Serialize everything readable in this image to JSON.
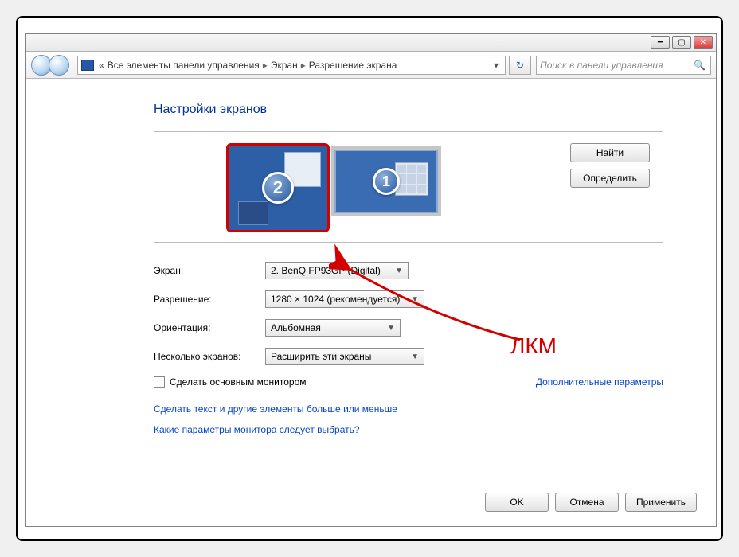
{
  "breadcrumb": {
    "prefix": "«",
    "item1": "Все элементы панели управления",
    "item2": "Экран",
    "item3": "Разрешение экрана"
  },
  "search": {
    "placeholder": "Поиск в панели управления"
  },
  "heading": "Настройки экранов",
  "preview": {
    "monitor2_num": "2",
    "monitor1_num": "1",
    "find_btn": "Найти",
    "identify_btn": "Определить"
  },
  "labels": {
    "screen": "Экран:",
    "resolution": "Разрешение:",
    "orientation": "Ориентация:",
    "multi": "Несколько экранов:"
  },
  "values": {
    "screen": "2. BenQ FP93GP (Digital)",
    "resolution": "1280 × 1024 (рекомендуется)",
    "orientation": "Альбомная",
    "multi": "Расширить эти экраны"
  },
  "checkbox_label": "Сделать основным монитором",
  "advanced_link": "Дополнительные параметры",
  "link1": "Сделать текст и другие элементы больше или меньше",
  "link2": "Какие параметры монитора следует выбрать?",
  "buttons": {
    "ok": "OK",
    "cancel": "Отмена",
    "apply": "Применить"
  },
  "annotation": "ЛКМ"
}
